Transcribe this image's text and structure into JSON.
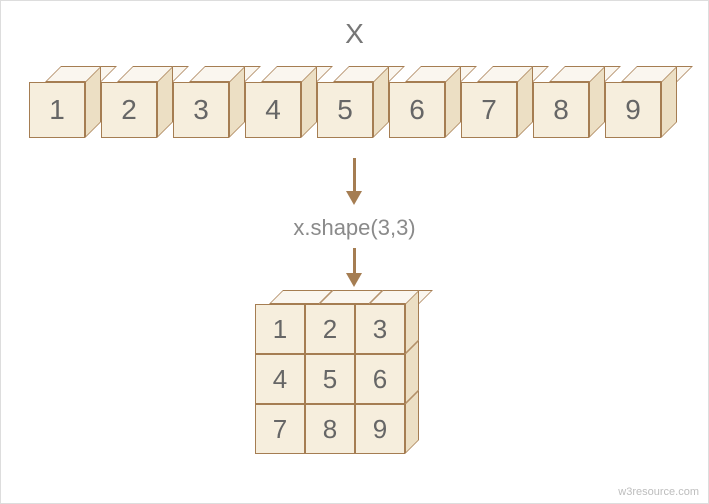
{
  "title": "X",
  "operation_label": "x.shape(3,3)",
  "watermark": "w3resource.com",
  "row_values": [
    "1",
    "2",
    "3",
    "4",
    "5",
    "6",
    "7",
    "8",
    "9"
  ],
  "grid_values": [
    [
      "1",
      "2",
      "3"
    ],
    [
      "4",
      "5",
      "6"
    ],
    [
      "7",
      "8",
      "9"
    ]
  ],
  "chart_data": {
    "type": "table",
    "description": "Reshape of a 1D array of length 9 into a 3x3 matrix",
    "input_array": [
      1,
      2,
      3,
      4,
      5,
      6,
      7,
      8,
      9
    ],
    "operation": "x.shape(3,3)",
    "output_matrix": [
      [
        1,
        2,
        3
      ],
      [
        4,
        5,
        6
      ],
      [
        7,
        8,
        9
      ]
    ],
    "output_shape": [
      3,
      3
    ]
  }
}
